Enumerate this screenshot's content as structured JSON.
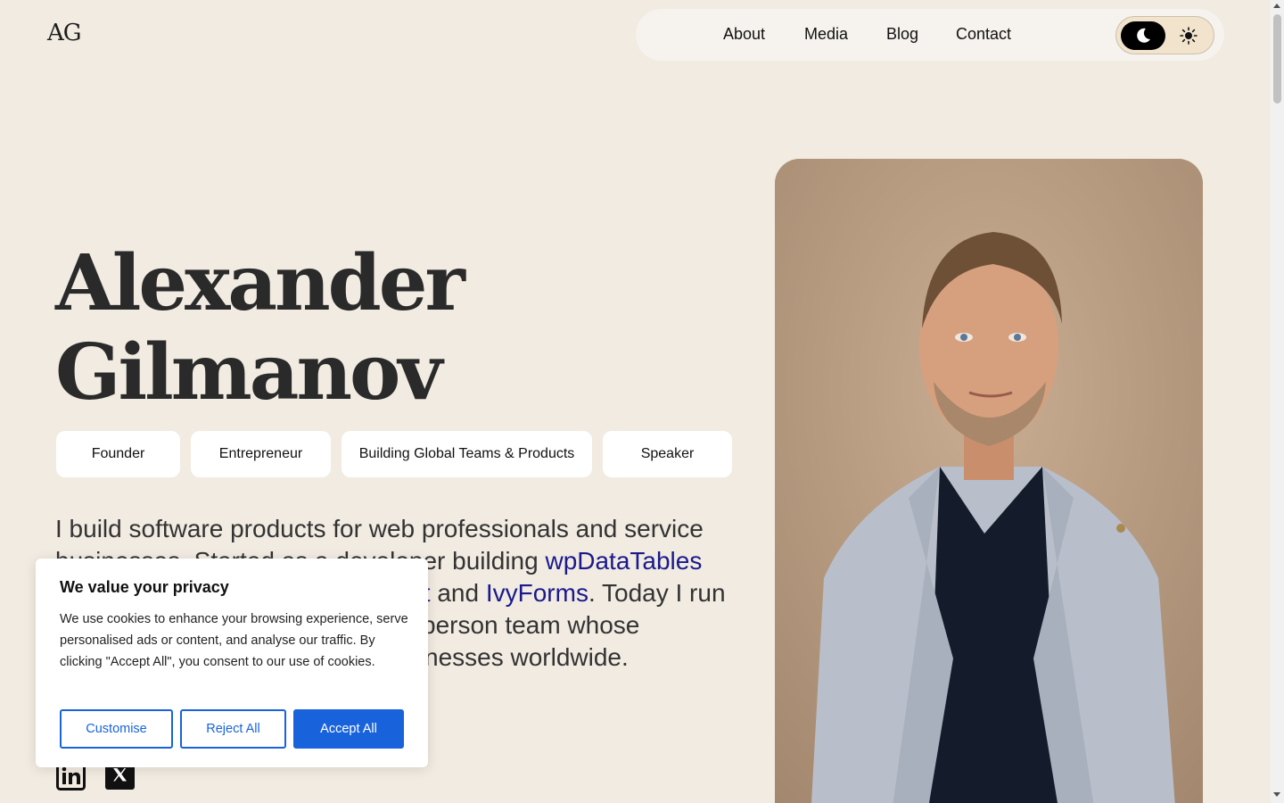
{
  "logo": "AG",
  "nav": {
    "links": [
      "About",
      "Media",
      "Blog",
      "Contact"
    ],
    "theme_toggle": {
      "active": "dark",
      "dark_icon": "moon-icon",
      "light_icon": "sun-icon"
    }
  },
  "hero": {
    "first_name": "Alexander",
    "last_name": "Gilmanov",
    "tags": [
      "Founder",
      "Entrepreneur",
      "Building Global Teams & Products",
      "Speaker"
    ],
    "intro": {
      "line1": "I build software products for web professionals and service",
      "line2_start": "businesses. Started as a developer building ",
      "link1": "wpDataTables",
      "link2_fragment": "ft",
      "and": " and ",
      "link3": "IvyForms",
      "line3_end": ". Today I run",
      "line4_fragment": "person team whose",
      "line5_fragment": "nesses worldwide."
    }
  },
  "social": [
    {
      "icon": "linkedin-icon"
    },
    {
      "icon": "x-twitter-icon"
    }
  ],
  "cookie_banner": {
    "title": "We value your privacy",
    "text": "We use cookies to enhance your browsing experience, serve personalised ads or content, and analyse our traffic. By clicking \"Accept All\", you consent to our use of cookies.",
    "customise": "Customise",
    "reject": "Reject All",
    "accept": "Accept All"
  },
  "colors": {
    "background": "#f1ebe1",
    "accent_link": "#1a1a8c",
    "cookie_button": "#1863dc"
  }
}
